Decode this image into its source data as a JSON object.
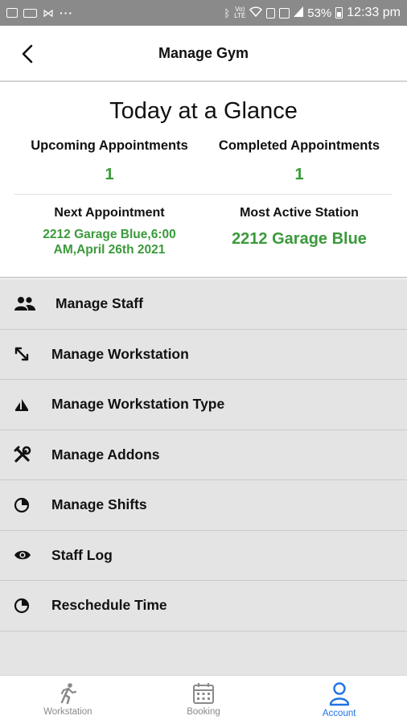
{
  "status_bar": {
    "battery": "53%",
    "time": "12:33 pm",
    "volte": "Vo) LTE"
  },
  "header": {
    "title": "Manage Gym"
  },
  "glance": {
    "title": "Today at a Glance",
    "upcoming_label": "Upcoming Appointments",
    "upcoming_value": "1",
    "completed_label": "Completed Appointments",
    "completed_value": "1",
    "next_label": "Next Appointment",
    "next_value_line1": "2212 Garage Blue,6:00",
    "next_value_line2": "AM,April 26th 2021",
    "most_active_label": "Most Active Station",
    "most_active_value": "2212 Garage Blue",
    "accent_color": "#3a9a3a"
  },
  "menu": [
    {
      "label": "Manage Staff",
      "icon": "people-icon"
    },
    {
      "label": "Manage Workstation",
      "icon": "arrows-icon"
    },
    {
      "label": "Manage Workstation Type",
      "icon": "shapes-icon"
    },
    {
      "label": "Manage Addons",
      "icon": "tools-icon"
    },
    {
      "label": "Manage Shifts",
      "icon": "pie-clock-icon"
    },
    {
      "label": "Staff Log",
      "icon": "eye-icon"
    },
    {
      "label": "Reschedule Time",
      "icon": "pie-clock-icon"
    }
  ],
  "bottom_nav": [
    {
      "label": "Workstation",
      "icon": "runner-icon"
    },
    {
      "label": "Booking",
      "icon": "calendar-icon"
    },
    {
      "label": "Account",
      "icon": "person-icon",
      "active": true
    }
  ],
  "colors": {
    "active_tab": "#1e73e6",
    "status_bar": "#8a8a8a",
    "menu_bg": "#e4e4e4"
  }
}
